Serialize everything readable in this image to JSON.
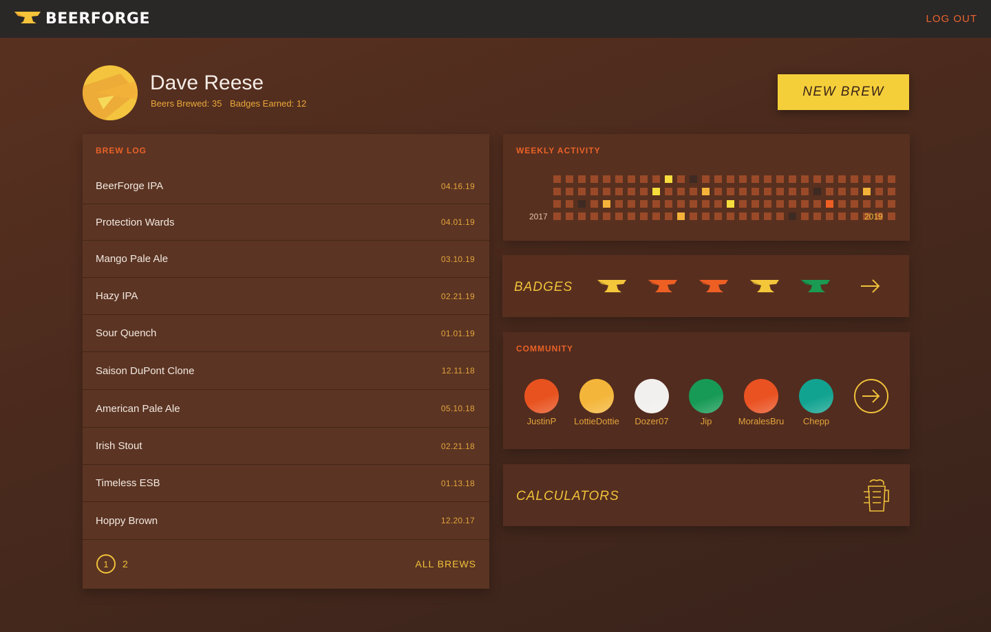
{
  "app": {
    "name": "BEERFORGE",
    "logout_label": "LOG OUT"
  },
  "profile": {
    "name": "Dave Reese",
    "beers_brewed": "Beers Brewed: 35",
    "badges_earned": "Badges Earned: 12"
  },
  "new_brew_label": "NEW BREW",
  "brew_log": {
    "title": "BREW LOG",
    "items": [
      {
        "name": "BeerForge IPA",
        "date": "04.16.19"
      },
      {
        "name": "Protection Wards",
        "date": "04.01.19"
      },
      {
        "name": "Mango Pale Ale",
        "date": "03.10.19"
      },
      {
        "name": "Hazy IPA",
        "date": "02.21.19"
      },
      {
        "name": "Sour Quench",
        "date": "01.01.19"
      },
      {
        "name": "Saison DuPont Clone",
        "date": "12.11.18"
      },
      {
        "name": "American Pale Ale",
        "date": "05.10.18"
      },
      {
        "name": "Irish Stout",
        "date": "02.21.18"
      },
      {
        "name": "Timeless ESB",
        "date": "01.13.18"
      },
      {
        "name": "Hoppy Brown",
        "date": "12.20.17"
      }
    ],
    "pages": [
      "1",
      "2"
    ],
    "current_page": "1",
    "all_brews_label": "ALL BREWS"
  },
  "weekly_activity": {
    "title": "WEEKLY ACTIVITY",
    "year_start": "2017",
    "year_end": "2019",
    "colors": {
      "empty": "#9a4a28",
      "dark": "#3e2a22",
      "yellow": "#f6dc3c",
      "gold": "#f4b23a",
      "orange": "#ee5f24"
    },
    "rows": [
      "000000000y0d0000000000000000",
      "00000000y000g00000000d000g00",
      "00d0g000000000y0000000o00000",
      "0000000000g00000000d00000000"
    ]
  },
  "badges": {
    "title": "BADGES",
    "items": [
      {
        "icon": "anvil-badge-icon",
        "color": "#f4c63a"
      },
      {
        "icon": "anvil-badge-icon",
        "color": "#ee5f24"
      },
      {
        "icon": "anvil-badge-icon",
        "color": "#ee5f24"
      },
      {
        "icon": "anvil-badge-icon",
        "color": "#f4c63a"
      },
      {
        "icon": "anvil-badge-icon",
        "color": "#1a9a52"
      }
    ],
    "more_icon": "arrow-right-icon"
  },
  "community": {
    "title": "COMMUNITY",
    "members": [
      {
        "name": "JustinP",
        "color": "#e8521f"
      },
      {
        "name": "LottieDottie",
        "color": "#f4b63a"
      },
      {
        "name": "Dozer07",
        "color": "#f2f0ee"
      },
      {
        "name": "Jip",
        "color": "#179a55"
      },
      {
        "name": "MoralesBru",
        "color": "#ea5222"
      },
      {
        "name": "Chepp",
        "color": "#12a390"
      }
    ],
    "more_icon": "arrow-right-circle-icon"
  },
  "calculators": {
    "title": "CALCULATORS",
    "icon": "beer-mug-icon"
  }
}
